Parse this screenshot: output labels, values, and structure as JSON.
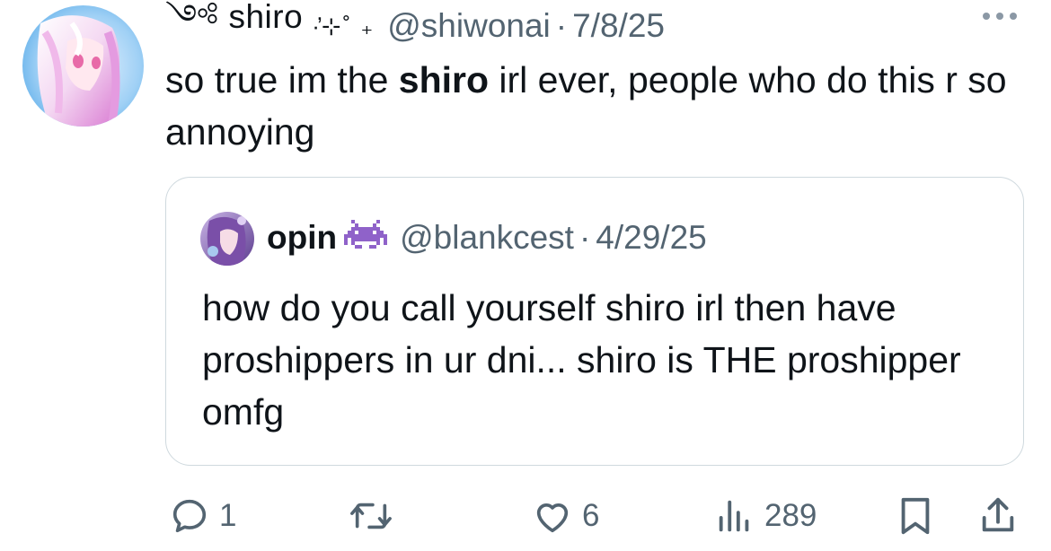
{
  "author": {
    "display_name_prefix": "༺ shiro",
    "sparkles": "·̕⊹˚ ₊",
    "handle": "@shiwonai",
    "separator": "·",
    "date": "7/8/25",
    "avatar_icon": "anime-avatar-icon"
  },
  "tweet": {
    "text_before": "so true im the ",
    "text_bold": "shiro",
    "text_after": " irl ever,  people who do this r so annoying"
  },
  "quoted_tweet": {
    "display_name": "opin",
    "emoji": "alien-monster-emoji",
    "handle": "@blankcest",
    "separator": "·",
    "date": "4/29/25",
    "text": "how do you call yourself shiro irl then have proshippers in ur dni... shiro is THE proshipper omfg"
  },
  "actions": {
    "replies": "1",
    "retweets": "",
    "likes": "6",
    "views": "289"
  },
  "colors": {
    "text_primary": "#0f1419",
    "text_secondary": "#536471",
    "border": "#cfd9de",
    "emoji_purple": "#8f62c9"
  }
}
